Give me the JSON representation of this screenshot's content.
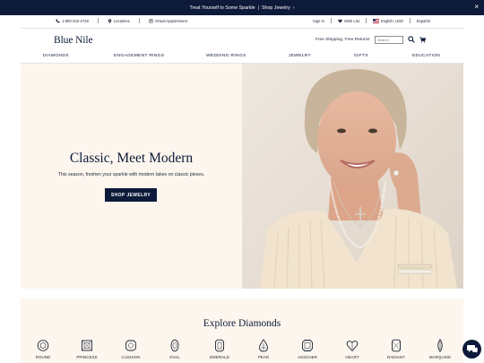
{
  "promo": {
    "text": "Treat Yourself to Some Sparkle",
    "separator": "|",
    "link": "Shop Jewelry",
    "arrow": "›",
    "close": "×"
  },
  "utility": {
    "phone": "1-800-242-2728",
    "locations": "Locations",
    "appointment": "Virtual Appointment",
    "sign_in": "Sign In",
    "wish_list": "Wish List",
    "locale": "English, USD",
    "espanol": "Español"
  },
  "header": {
    "logo": "Blue Nile",
    "shipping": "Free Shipping, Free Returns",
    "search_placeholder": "Search"
  },
  "nav": [
    "DIAMONDS",
    "ENGAGEMENT RINGS",
    "WEDDING RINGS",
    "JEWELRY",
    "GIFTS",
    "EDUCATION"
  ],
  "hero": {
    "title": "Classic, Meet Modern",
    "subtitle": "This season, freshen your sparkle with modern takes on classic pieces.",
    "button": "SHOP JEWELRY"
  },
  "explore": {
    "title": "Explore Diamonds",
    "shapes": [
      "ROUND",
      "PRINCESS",
      "CUSHION",
      "OVAL",
      "EMERALD",
      "PEAR",
      "ASSCHER",
      "HEART",
      "RADIANT",
      "MARQUISE"
    ]
  },
  "colors": {
    "navy": "#0d1a39",
    "cream": "#fdf6ee",
    "text": "#1b2537"
  },
  "icons": {
    "phone": "phone-icon",
    "location": "location-pin-icon",
    "video": "video-icon",
    "heart": "heart-icon",
    "flag": "us-flag-icon",
    "search": "search-icon",
    "cart": "cart-icon",
    "chat": "chat-icon",
    "close": "close-icon"
  }
}
